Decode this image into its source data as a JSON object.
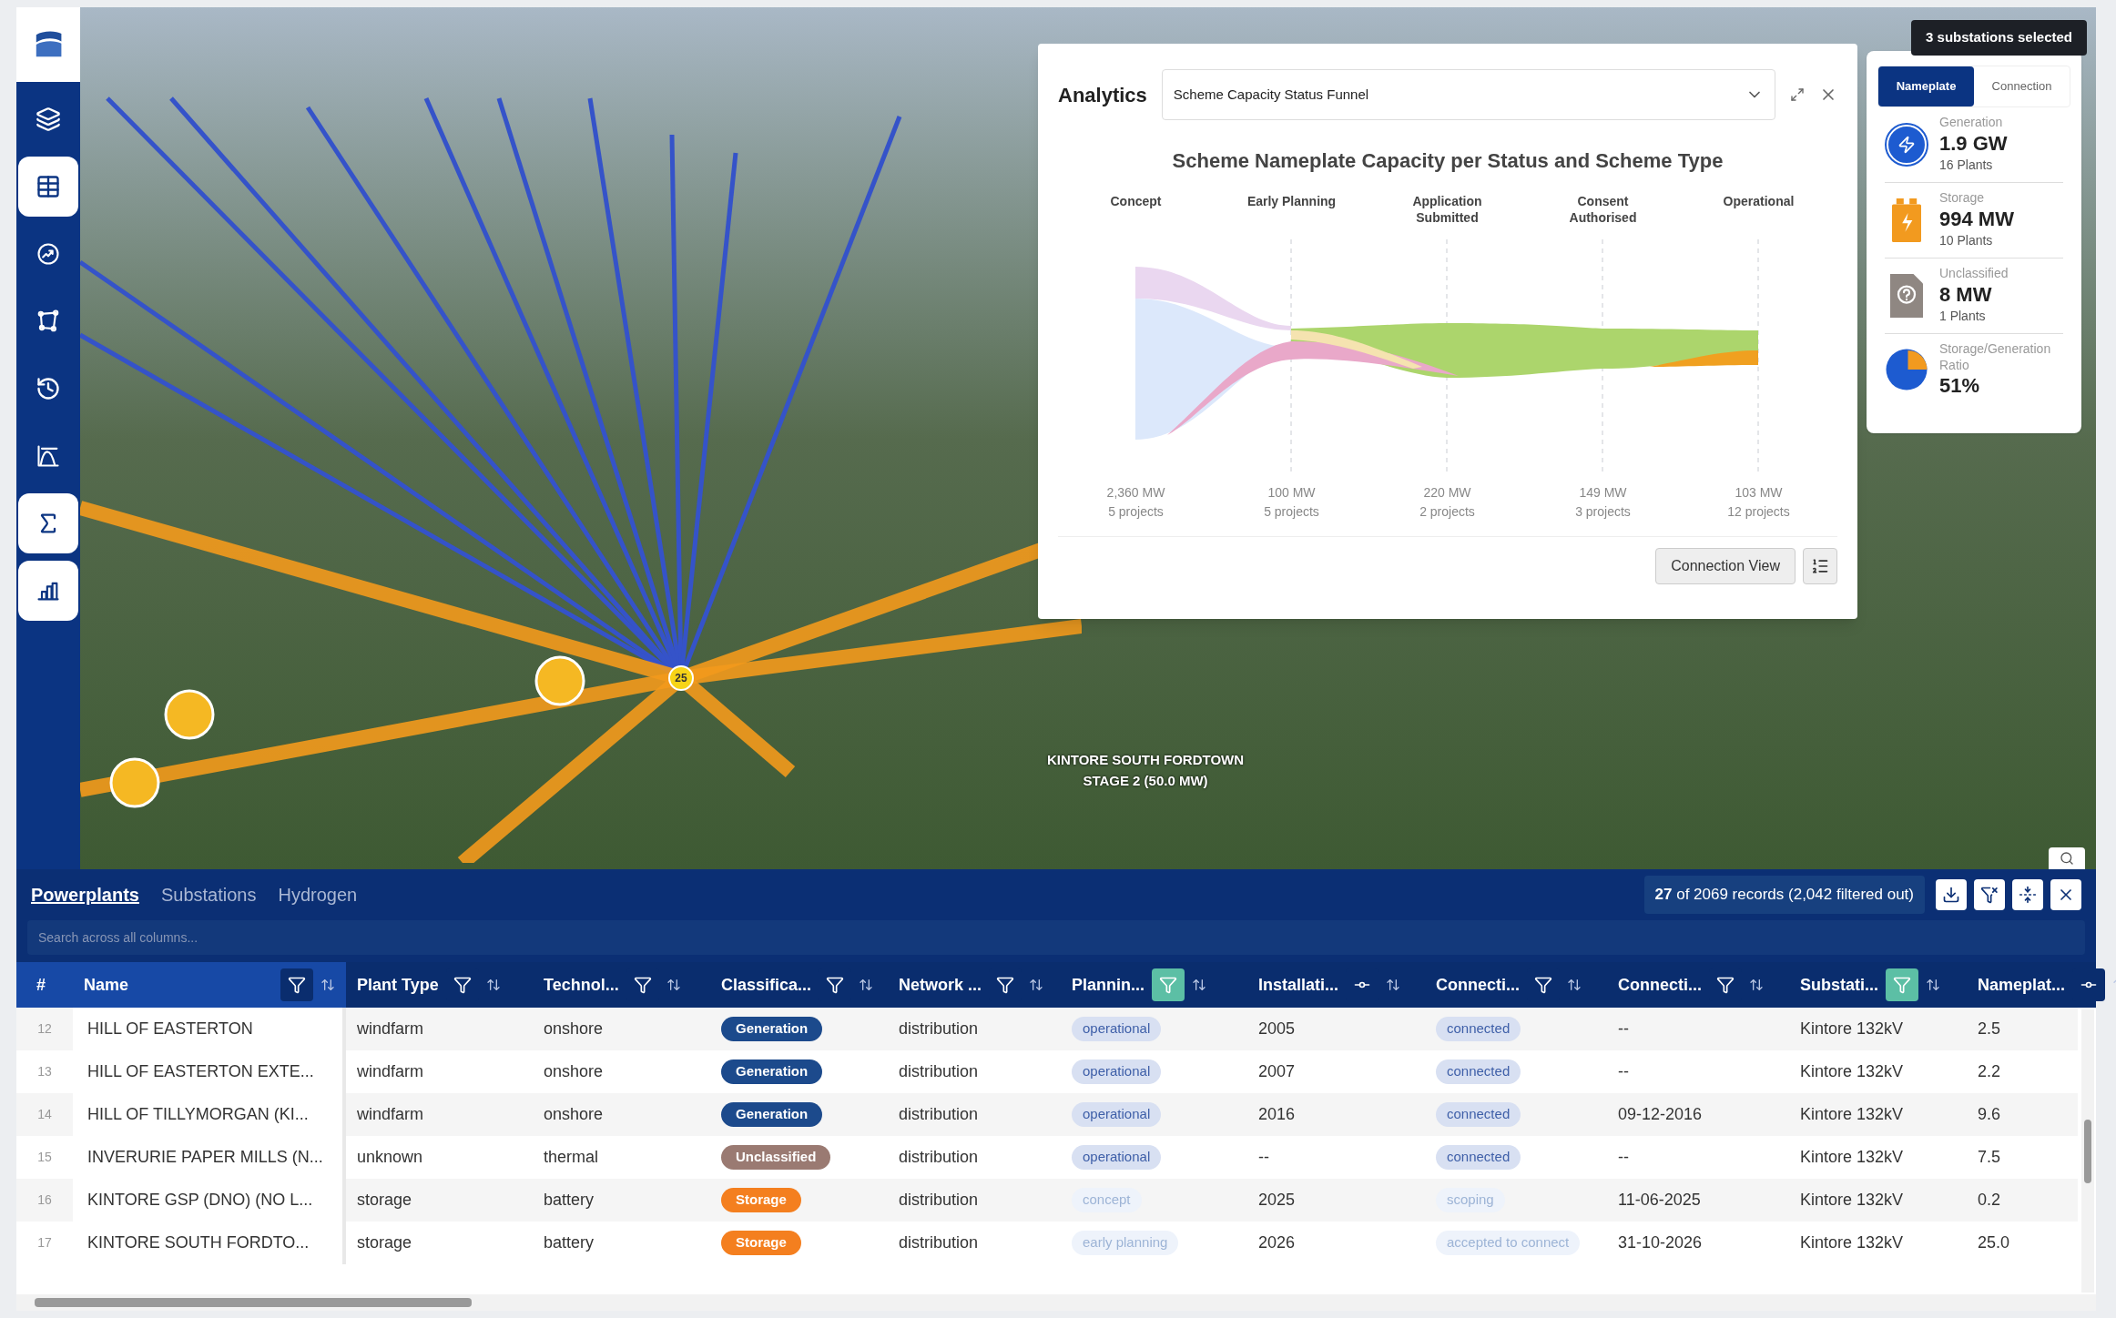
{
  "sidebar": {
    "items": [
      {
        "active": false
      },
      {
        "active": true
      },
      {
        "active": false
      },
      {
        "active": false
      },
      {
        "active": false
      },
      {
        "active": false
      },
      {
        "active": true
      },
      {
        "active": true
      }
    ]
  },
  "map": {
    "cluster_count": "25",
    "label": "KINTORE SOUTH FORDTOWN STAGE 2 (50.0 MW)"
  },
  "selection_badge": "3 substations selected",
  "analytics": {
    "title": "Analytics",
    "select_value": "Scheme Capacity Status Funnel",
    "chart_title": "Scheme Nameplate Capacity per Status and Scheme Type",
    "stages": [
      {
        "name": "Concept",
        "capacity": "2,360 MW",
        "projects": "5 projects"
      },
      {
        "name": "Early Planning",
        "capacity": "100 MW",
        "projects": "5 projects"
      },
      {
        "name": "Application Submitted",
        "capacity": "220 MW",
        "projects": "2 projects"
      },
      {
        "name": "Consent Authorised",
        "capacity": "149 MW",
        "projects": "3 projects"
      },
      {
        "name": "Operational",
        "capacity": "103 MW",
        "projects": "12 projects"
      }
    ],
    "button": "Connection View"
  },
  "stats": {
    "tabs": [
      {
        "label": "Nameplate",
        "selected": true
      },
      {
        "label": "Connection",
        "selected": false
      }
    ],
    "items": [
      {
        "kind": "generation",
        "label": "Generation",
        "value": "1.9 GW",
        "sub": "16 Plants"
      },
      {
        "kind": "storage",
        "label": "Storage",
        "value": "994 MW",
        "sub": "10 Plants"
      },
      {
        "kind": "unclassified",
        "label": "Unclassified",
        "value": "8 MW",
        "sub": "1 Plants"
      },
      {
        "kind": "ratio",
        "label": "Storage/Generation Ratio",
        "value": "51%"
      }
    ]
  },
  "table": {
    "tabs": [
      {
        "label": "Powerplants",
        "selected": true
      },
      {
        "label": "Substations",
        "selected": false
      },
      {
        "label": "Hydrogen",
        "selected": false
      }
    ],
    "records": "**27** of 2069 records (2,042 filtered out)",
    "search_placeholder": "Search across all columns...",
    "columns": [
      {
        "label": "#"
      },
      {
        "label": "Name",
        "kind": "funnel",
        "filter_active": false
      },
      {
        "label": "Plant Type",
        "kind": "funnel",
        "filter_active": false
      },
      {
        "label": "Technol...",
        "kind": "funnel",
        "filter_active": false
      },
      {
        "label": "Classifica...",
        "kind": "funnel",
        "filter_active": false
      },
      {
        "label": "Network ...",
        "kind": "funnel",
        "filter_active": false
      },
      {
        "label": "Plannin...",
        "kind": "funnel",
        "filter_active": true
      },
      {
        "label": "Installati...",
        "kind": "range",
        "filter_active": false
      },
      {
        "label": "Connecti...",
        "kind": "funnel",
        "filter_active": false
      },
      {
        "label": "Connecti...",
        "kind": "funnel",
        "filter_active": false
      },
      {
        "label": "Substati...",
        "kind": "funnel",
        "filter_active": true
      },
      {
        "label": "Nameplat...",
        "kind": "range",
        "filter_active": false
      }
    ],
    "rows": [
      {
        "index": "12",
        "name": "HILL OF EASTERTON",
        "plant_type": "windfarm",
        "technology": "onshore",
        "classification": {
          "text": "Generation",
          "color": "#1c4a8c"
        },
        "network": "distribution",
        "planning": {
          "text": "operational",
          "muted": false
        },
        "installation": "2005",
        "connection_status": {
          "text": "connected",
          "muted": false
        },
        "connection_date": "--",
        "substation": "Kintore 132kV",
        "nameplate": "2.5"
      },
      {
        "index": "13",
        "name": "HILL OF EASTERTON EXTE...",
        "plant_type": "windfarm",
        "technology": "onshore",
        "classification": {
          "text": "Generation",
          "color": "#1c4a8c"
        },
        "network": "distribution",
        "planning": {
          "text": "operational",
          "muted": false
        },
        "installation": "2007",
        "connection_status": {
          "text": "connected",
          "muted": false
        },
        "connection_date": "--",
        "substation": "Kintore 132kV",
        "nameplate": "2.2"
      },
      {
        "index": "14",
        "name": "HILL OF TILLYMORGAN (KI...",
        "plant_type": "windfarm",
        "technology": "onshore",
        "classification": {
          "text": "Generation",
          "color": "#1c4a8c"
        },
        "network": "distribution",
        "planning": {
          "text": "operational",
          "muted": false
        },
        "installation": "2016",
        "connection_status": {
          "text": "connected",
          "muted": false
        },
        "connection_date": "09-12-2016",
        "substation": "Kintore 132kV",
        "nameplate": "9.6"
      },
      {
        "index": "15",
        "name": "INVERURIE PAPER MILLS (N...",
        "plant_type": "unknown",
        "technology": "thermal",
        "classification": {
          "text": "Unclassified",
          "color": "#9a7a72"
        },
        "network": "distribution",
        "planning": {
          "text": "operational",
          "muted": false
        },
        "installation": "--",
        "connection_status": {
          "text": "connected",
          "muted": false
        },
        "connection_date": "--",
        "substation": "Kintore 132kV",
        "nameplate": "7.5"
      },
      {
        "index": "16",
        "name": "KINTORE GSP (DNO) (NO L...",
        "plant_type": "storage",
        "technology": "battery",
        "classification": {
          "text": "Storage",
          "color": "#f47f1f"
        },
        "network": "distribution",
        "planning": {
          "text": "concept",
          "muted": true
        },
        "installation": "2025",
        "connection_status": {
          "text": "scoping",
          "muted": true
        },
        "connection_date": "11-06-2025",
        "substation": "Kintore 132kV",
        "nameplate": "0.2"
      },
      {
        "index": "17",
        "name": "KINTORE SOUTH FORDTO...",
        "plant_type": "storage",
        "technology": "battery",
        "classification": {
          "text": "Storage",
          "color": "#f47f1f"
        },
        "network": "distribution",
        "planning": {
          "text": "early planning",
          "muted": true
        },
        "installation": "2026",
        "connection_status": {
          "text": "accepted to connect",
          "muted": true
        },
        "connection_date": "31-10-2026",
        "substation": "Kintore 132kV",
        "nameplate": "25.0"
      }
    ]
  }
}
